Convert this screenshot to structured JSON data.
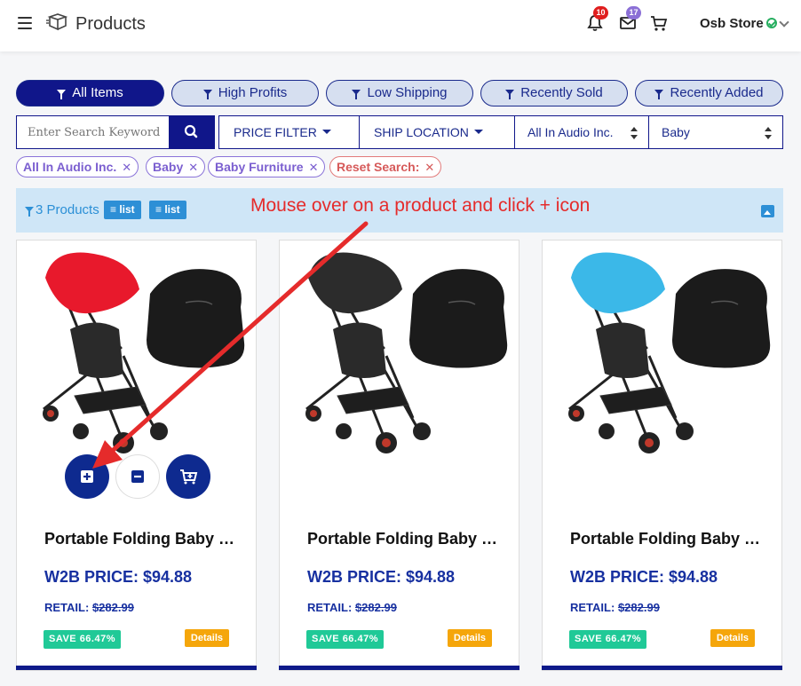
{
  "header": {
    "title": "Products",
    "notifications_count": "10",
    "messages_count": "17",
    "store_name": "Osb Store",
    "colors": {
      "notif_badge": "#e01e1e",
      "msg_badge": "#8b6fd6"
    }
  },
  "filter_tabs": [
    {
      "label": "All Items",
      "active": true
    },
    {
      "label": "High Profits",
      "active": false
    },
    {
      "label": "Low Shipping",
      "active": false
    },
    {
      "label": "Recently Sold",
      "active": false
    },
    {
      "label": "Recently Added",
      "active": false
    }
  ],
  "search": {
    "value": "",
    "placeholder": "Enter Search Keyword"
  },
  "filters": {
    "price_filter": "PRICE FILTER",
    "ship_location": "SHIP LOCATION",
    "supplier": "All In Audio Inc.",
    "category": "Baby"
  },
  "chips": [
    {
      "label": "All In Audio Inc.",
      "type": "filter"
    },
    {
      "label": "Baby",
      "type": "filter"
    },
    {
      "label": "Baby Furniture",
      "type": "filter"
    },
    {
      "label": "Reset Search:",
      "type": "reset"
    }
  ],
  "info_bar": {
    "count_label": "3 Products",
    "view_buttons": [
      "list",
      "list"
    ]
  },
  "annotation": "Mouse over on a product and click + icon",
  "products": [
    {
      "title": "Portable Folding Baby Stroller",
      "price_label": "W2B PRICE: $94.88",
      "retail_label": "RETAIL:",
      "retail_value": "$282.99",
      "save_label": "SAVE 66.47%",
      "details_label": "Details",
      "canopy_color": "#e8192c",
      "show_actions": true
    },
    {
      "title": "Portable Folding Baby Stroller",
      "price_label": "W2B PRICE: $94.88",
      "retail_label": "RETAIL:",
      "retail_value": "$282.99",
      "save_label": "SAVE 66.47%",
      "details_label": "Details",
      "canopy_color": "#2c2c2c",
      "show_actions": false
    },
    {
      "title": "Portable Folding Baby Stroller",
      "price_label": "W2B PRICE: $94.88",
      "retail_label": "RETAIL:",
      "retail_value": "$282.99",
      "save_label": "SAVE 66.47%",
      "details_label": "Details",
      "canopy_color": "#3bb8e8",
      "show_actions": false
    }
  ],
  "colors": {
    "primary": "#10168a",
    "info_bg": "#cfe6f7",
    "save_green": "#20c997",
    "details_orange": "#f5a60b",
    "annotation_red": "#e52b2b"
  }
}
